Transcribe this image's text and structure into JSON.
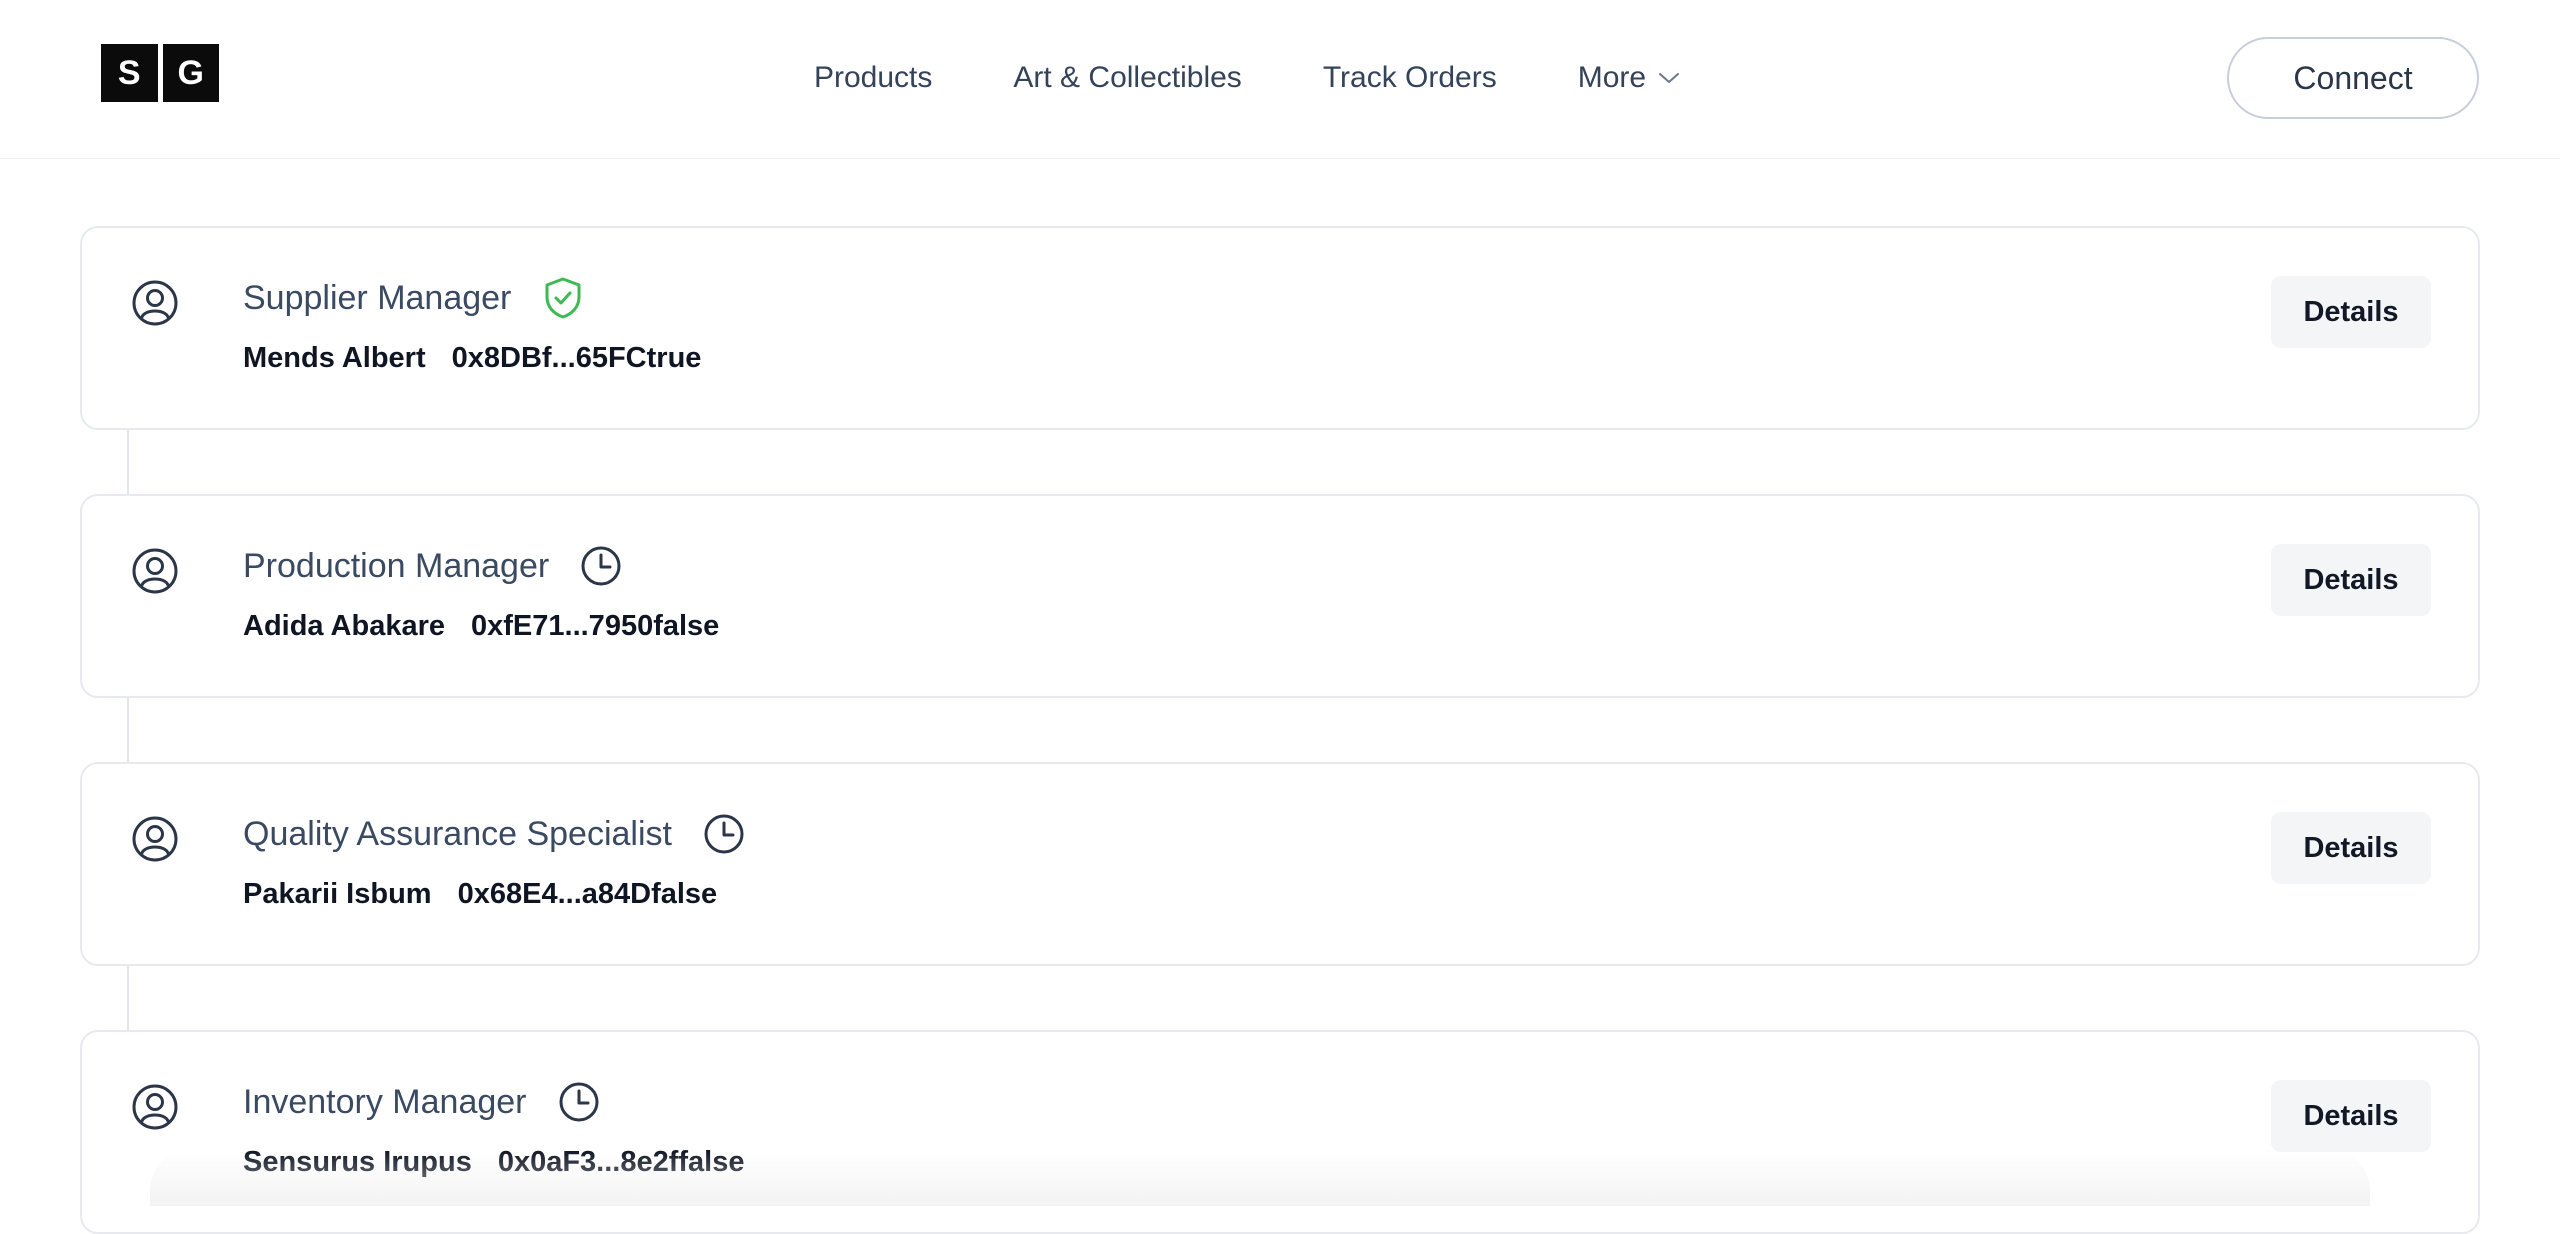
{
  "header": {
    "logo": {
      "left_letter": "S",
      "right_letter": "G"
    },
    "nav": [
      {
        "label": "Products"
      },
      {
        "label": "Art & Collectibles"
      },
      {
        "label": "Track Orders"
      },
      {
        "label": "More"
      }
    ],
    "connect_label": "Connect"
  },
  "roles": [
    {
      "role": "Supplier Manager",
      "status_icon": "verified-shield-icon",
      "name": "Mends Albert",
      "address": "0x8DBf...65FCtrue",
      "details_label": "Details"
    },
    {
      "role": "Production Manager",
      "status_icon": "clock-icon",
      "name": "Adida Abakare",
      "address": "0xfE71...7950false",
      "details_label": "Details"
    },
    {
      "role": "Quality Assurance Specialist",
      "status_icon": "clock-icon",
      "name": "Pakarii Isbum",
      "address": "0x68E4...a84Dfalse",
      "details_label": "Details"
    },
    {
      "role": "Inventory Manager",
      "status_icon": "clock-icon",
      "name": "Sensurus Irupus",
      "address": "0x0aF3...8e2ffalse",
      "details_label": "Details"
    }
  ],
  "colors": {
    "verified": "#3dba54",
    "icon": "#2b3648",
    "border": "#e7e9ee"
  }
}
